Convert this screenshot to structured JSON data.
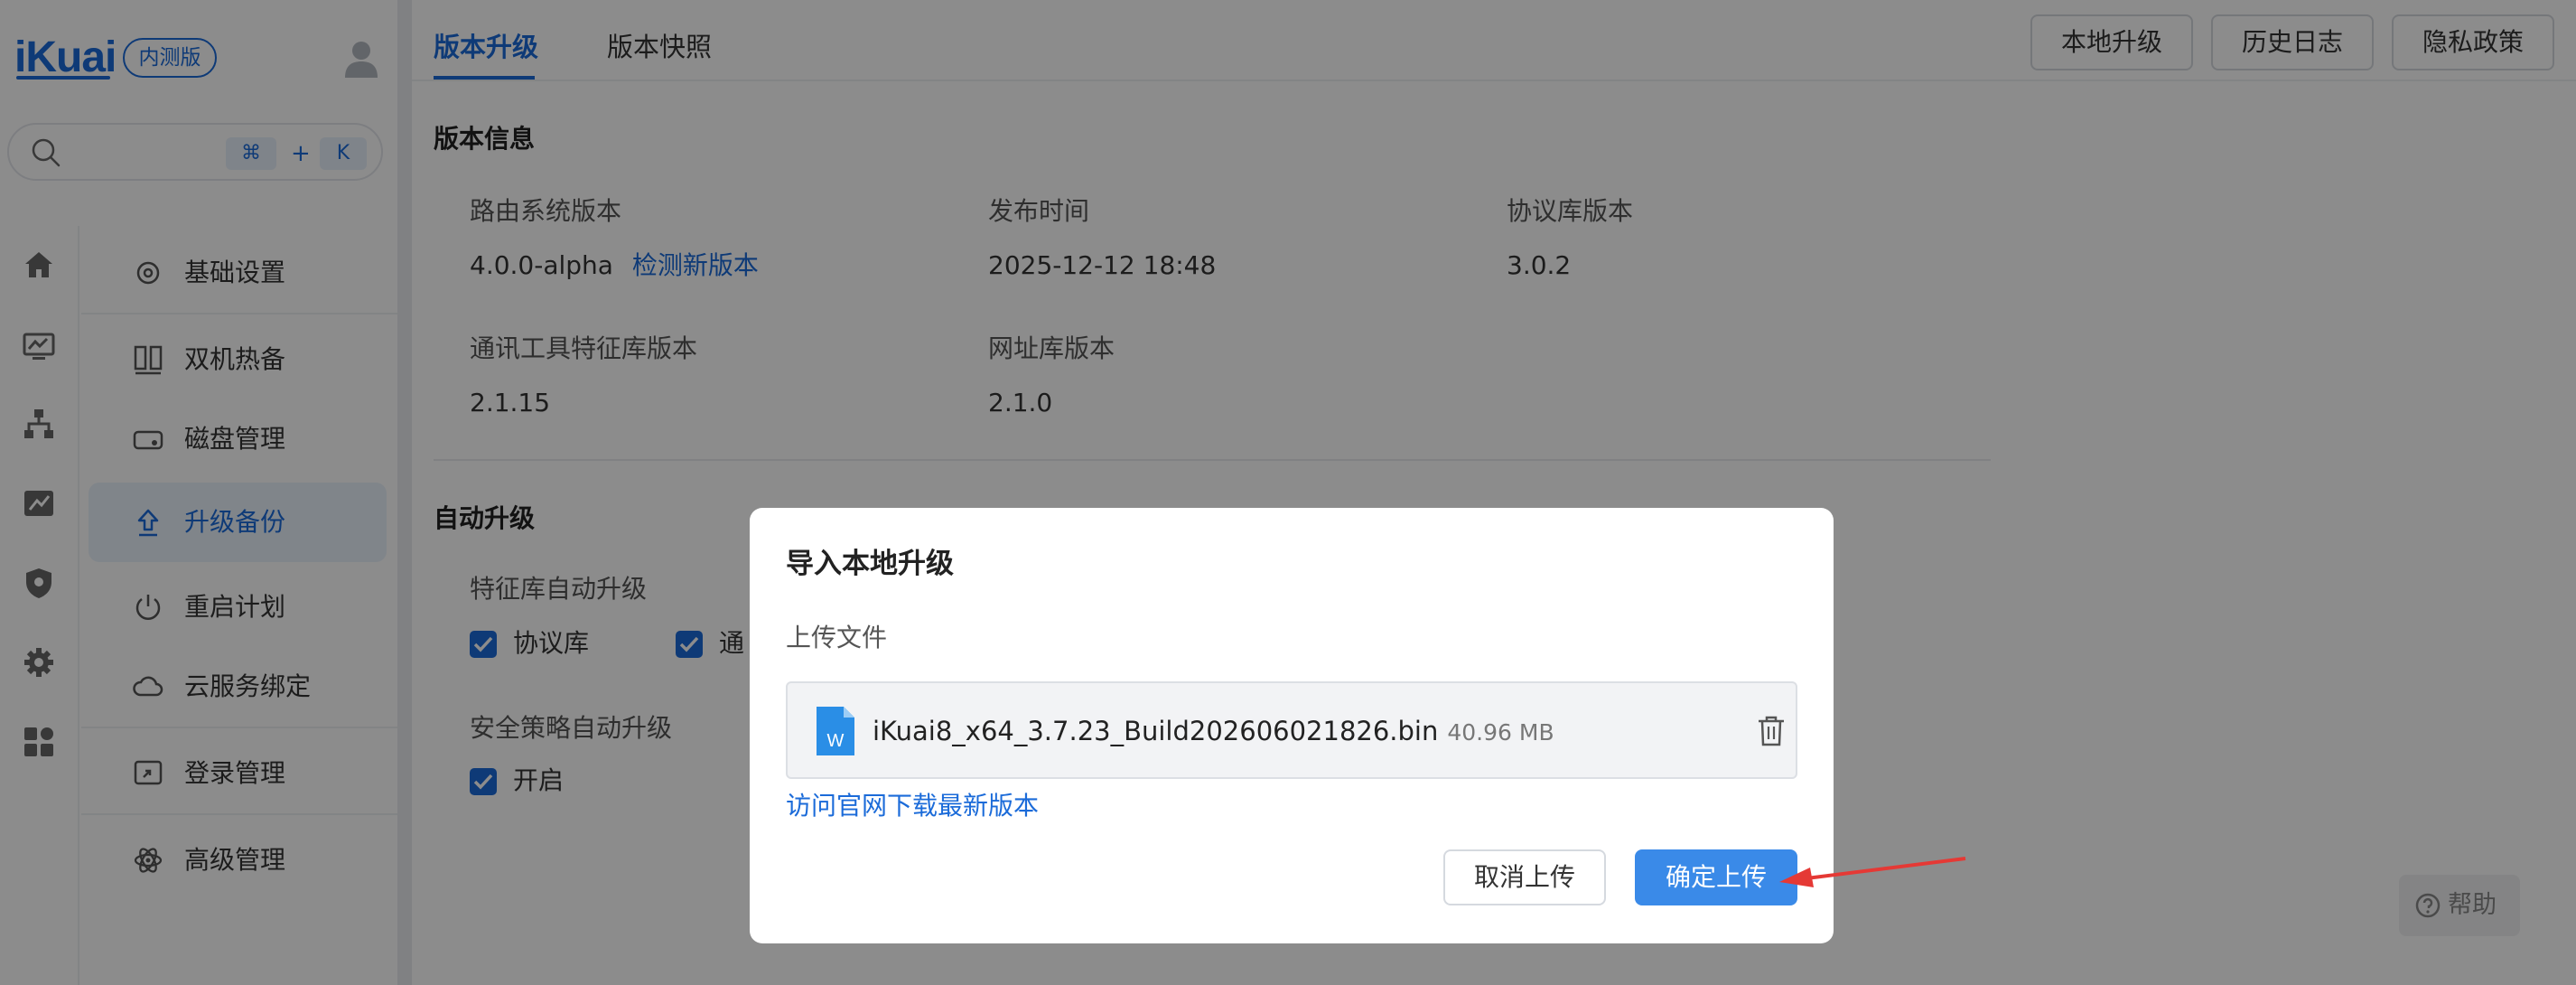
{
  "brand": {
    "logo_text": "iKuai",
    "badge": "内测版"
  },
  "search": {
    "shortcut_cmd": "⌘",
    "shortcut_plus": "+",
    "shortcut_key": "K"
  },
  "rail": {
    "icons": [
      "home-icon",
      "monitor-icon",
      "network-icon",
      "flow-icon",
      "shield-icon",
      "gear-icon",
      "apps-icon"
    ]
  },
  "sidebar": {
    "items": [
      {
        "label": "基础设置",
        "icon": "gear-outline-icon"
      },
      {
        "label": "双机热备",
        "icon": "servers-icon"
      },
      {
        "label": "磁盘管理",
        "icon": "disk-icon"
      },
      {
        "label": "升级备份",
        "icon": "upload-icon",
        "active": true
      },
      {
        "label": "重启计划",
        "icon": "power-icon"
      },
      {
        "label": "云服务绑定",
        "icon": "cloud-icon"
      },
      {
        "label": "登录管理",
        "icon": "login-icon"
      },
      {
        "label": "高级管理",
        "icon": "atom-icon"
      }
    ]
  },
  "tabs": [
    {
      "label": "版本升级",
      "active": true
    },
    {
      "label": "版本快照",
      "active": false
    }
  ],
  "toolbar": {
    "local_upgrade": "本地升级",
    "history_log": "历史日志",
    "privacy_policy": "隐私政策"
  },
  "version_info": {
    "title": "版本信息",
    "router_version_label": "路由系统版本",
    "router_version_value": "4.0.0-alpha",
    "check_new_version": "检测新版本",
    "release_time_label": "发布时间",
    "release_time_value": "2025-12-12 18:48",
    "protocol_lib_label": "协议库版本",
    "protocol_lib_value": "3.0.2",
    "comm_tool_label": "通讯工具特征库版本",
    "comm_tool_value": "2.1.15",
    "url_lib_label": "网址库版本",
    "url_lib_value": "2.1.0"
  },
  "auto_upgrade": {
    "title": "自动升级",
    "feature_lib_label": "特征库自动升级",
    "protocol_checkbox": "协议库",
    "comm_checkbox_partial": "通",
    "security_label": "安全策略自动升级",
    "enable_checkbox": "开启"
  },
  "help": {
    "label": "帮助"
  },
  "modal": {
    "title": "导入本地升级",
    "upload_label": "上传文件",
    "file_name": "iKuai8_x64_3.7.23_Build202606021826.bin",
    "file_size": "40.96 MB",
    "download_link": "访问官网下载最新版本",
    "cancel_button": "取消上传",
    "confirm_button": "确定上传"
  },
  "colors": {
    "accent": "#1b6bd9",
    "confirm": "#3a8ae8",
    "annotation_arrow": "#e53935"
  }
}
